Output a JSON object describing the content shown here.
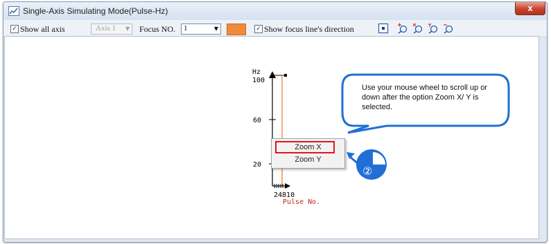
{
  "window": {
    "title": "Single-Axis Simulating Mode(Pulse-Hz)",
    "close_glyph": "x"
  },
  "toolbar": {
    "show_all_axis": {
      "label": "Show all axis",
      "checked": true
    },
    "axis_select": {
      "value": "Axis 1",
      "enabled": false
    },
    "focus_label": "Focus NO.",
    "focus_select": {
      "value": "1"
    },
    "focus_color": "#f08a3c",
    "show_direction": {
      "label": "Show focus line's direction",
      "checked": true
    },
    "tools": [
      "fit-view-icon",
      "zoom-in-icon",
      "zoom-x-icon",
      "zoom-y-icon",
      "zoom-out-icon"
    ]
  },
  "chart_data": {
    "type": "line",
    "ylabel": "Hz",
    "xlabel": "Pulse No.",
    "y_ticks": [
      "100",
      "60",
      "20"
    ],
    "x_tick_text": "24810",
    "y_top_overlap_text": "100",
    "focus_line_color": "#f08a3c"
  },
  "context_menu": {
    "items": [
      "Zoom X",
      "Zoom Y"
    ],
    "highlighted": "Zoom X"
  },
  "callout": {
    "text": "Use your mouse wheel to scroll up or down after the option Zoom X/ Y is selected."
  },
  "step_badge": {
    "number": "②"
  }
}
